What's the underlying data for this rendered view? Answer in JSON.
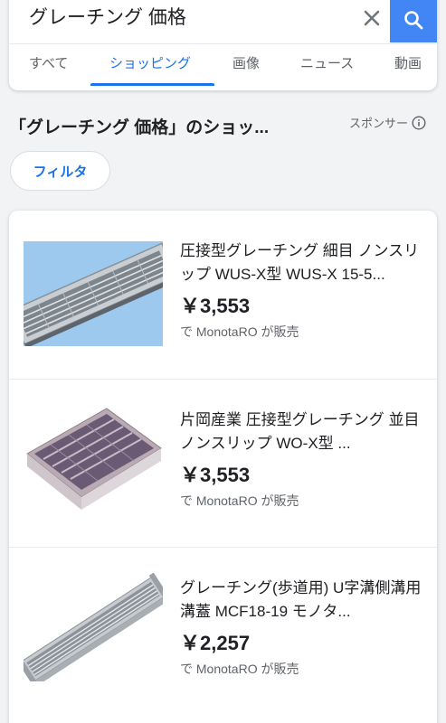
{
  "search": {
    "query": "グレーチング 価格",
    "clear_label": "✕"
  },
  "tabs": [
    {
      "label": "すべて"
    },
    {
      "label": "ショッピング"
    },
    {
      "label": "画像"
    },
    {
      "label": "ニュース"
    },
    {
      "label": "動画"
    }
  ],
  "section": {
    "title": "「グレーチング 価格」のショッ...",
    "sponsor_label": "スポンサー",
    "filter_label": "フィルタ"
  },
  "products": [
    {
      "title": "圧接型グレーチング 細目 ノンスリップ WUS-X型 WUS-X 15-5...",
      "price": "￥3,553",
      "seller": "で MonotaRO が販売"
    },
    {
      "title": "片岡産業 圧接型グレーチング 並目 ノンスリップ WO-X型 ...",
      "price": "￥3,553",
      "seller": "で MonotaRO が販売"
    },
    {
      "title": "グレーチング(歩道用) U字溝側溝用 溝蓋 MCF18-19 モノタ...",
      "price": "￥2,257",
      "seller": "で MonotaRO が販売"
    }
  ],
  "colors": {
    "accent": "#1a73e8",
    "search_button": "#4285f4"
  }
}
